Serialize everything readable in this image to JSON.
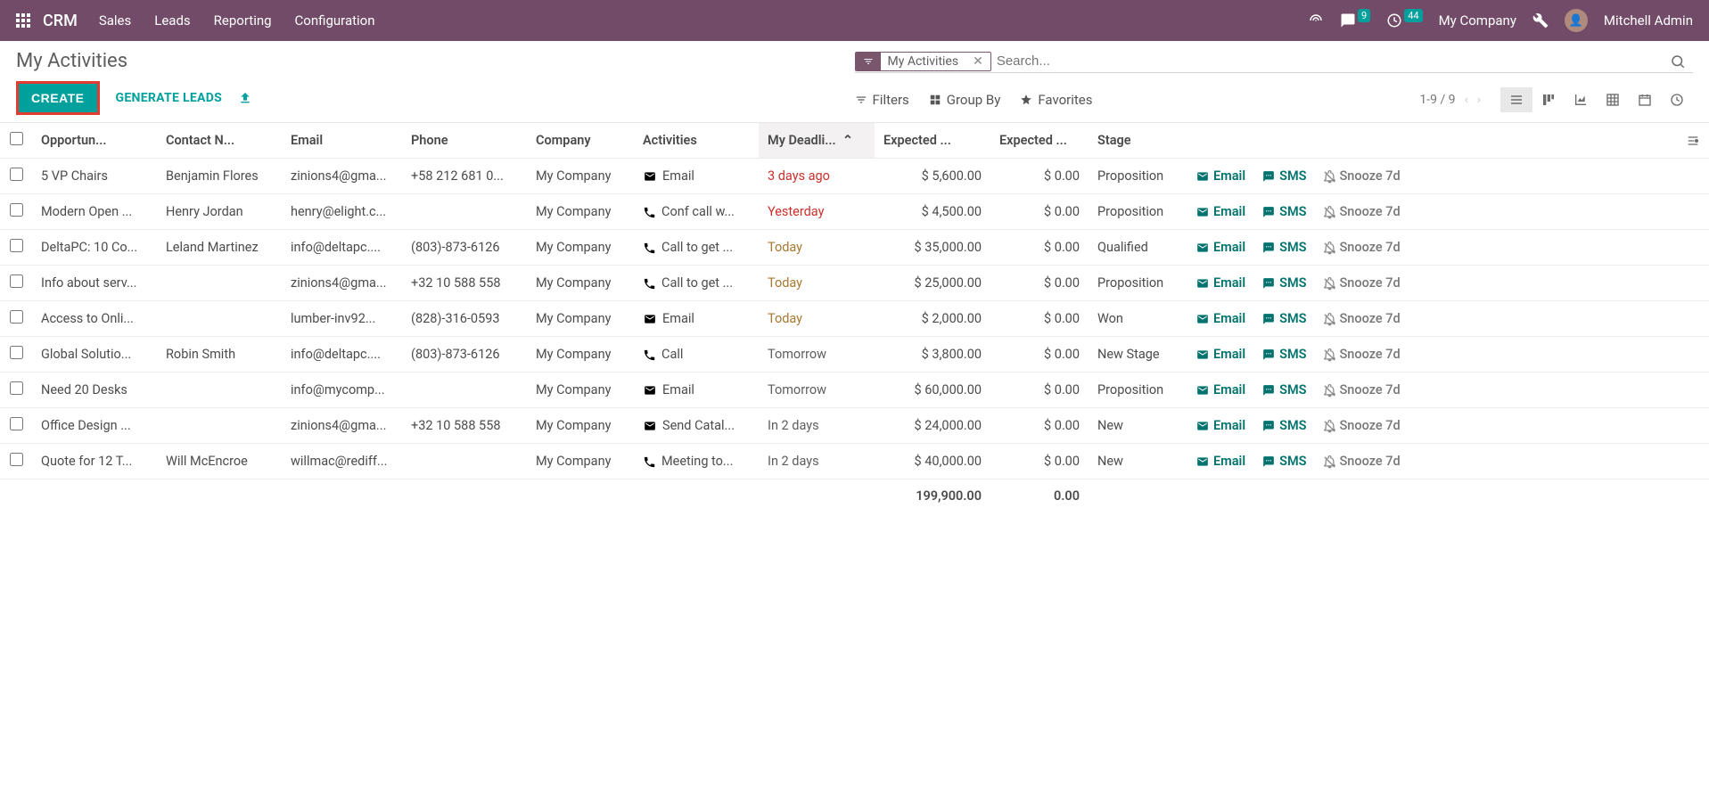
{
  "topnav": {
    "brand": "CRM",
    "menu": [
      "Sales",
      "Leads",
      "Reporting",
      "Configuration"
    ],
    "messages_badge": "9",
    "activities_badge": "44",
    "company": "My Company",
    "user": "Mitchell Admin"
  },
  "page_title": "My Activities",
  "actions": {
    "create": "CREATE",
    "generate_leads": "GENERATE LEADS"
  },
  "search": {
    "facet_label": "My Activities",
    "placeholder": "Search..."
  },
  "toolbar": {
    "filters": "Filters",
    "groupby": "Group By",
    "favorites": "Favorites",
    "pager": "1-9 / 9"
  },
  "columns": {
    "opportunity": "Opportun...",
    "contact": "Contact N...",
    "email": "Email",
    "phone": "Phone",
    "company": "Company",
    "activities": "Activities",
    "deadline": "My Deadli...",
    "expected_rev": "Expected ...",
    "expected_mrr": "Expected ...",
    "stage": "Stage"
  },
  "row_action_labels": {
    "email": "Email",
    "sms": "SMS",
    "snooze": "Snooze 7d"
  },
  "rows": [
    {
      "opportunity": "5 VP Chairs",
      "contact": "Benjamin Flores",
      "email": "zinions4@gma...",
      "phone": "+58 212 681 0...",
      "company": "My Company",
      "activity": "Email",
      "activity_icon": "envelope",
      "activity_color": "red",
      "deadline": "3 days ago",
      "deadline_color": "red",
      "expected_rev": "$ 5,600.00",
      "expected_mrr": "$ 0.00",
      "stage": "Proposition"
    },
    {
      "opportunity": "Modern Open ...",
      "contact": "Henry Jordan",
      "email": "henry@elight.c...",
      "phone": "",
      "company": "My Company",
      "activity": "Conf call w...",
      "activity_icon": "phone",
      "activity_color": "red",
      "deadline": "Yesterday",
      "deadline_color": "red",
      "expected_rev": "$ 4,500.00",
      "expected_mrr": "$ 0.00",
      "stage": "Proposition"
    },
    {
      "opportunity": "DeltaPC: 10 Co...",
      "contact": "Leland Martinez",
      "email": "info@deltapc....",
      "phone": "(803)-873-6126",
      "company": "My Company",
      "activity": "Call to get ...",
      "activity_icon": "phone",
      "activity_color": "brown",
      "deadline": "Today",
      "deadline_color": "brown",
      "expected_rev": "$ 35,000.00",
      "expected_mrr": "$ 0.00",
      "stage": "Qualified"
    },
    {
      "opportunity": "Info about serv...",
      "contact": "",
      "email": "zinions4@gma...",
      "phone": "+32 10 588 558",
      "company": "My Company",
      "activity": "Call to get ...",
      "activity_icon": "phone",
      "activity_color": "brown",
      "deadline": "Today",
      "deadline_color": "brown",
      "expected_rev": "$ 25,000.00",
      "expected_mrr": "$ 0.00",
      "stage": "Proposition"
    },
    {
      "opportunity": "Access to Onli...",
      "contact": "",
      "email": "lumber-inv92...",
      "phone": "(828)-316-0593",
      "company": "My Company",
      "activity": "Email",
      "activity_icon": "envelope",
      "activity_color": "brown",
      "deadline": "Today",
      "deadline_color": "brown",
      "expected_rev": "$ 2,000.00",
      "expected_mrr": "$ 0.00",
      "stage": "Won"
    },
    {
      "opportunity": "Global Solutio...",
      "contact": "Robin Smith",
      "email": "info@deltapc....",
      "phone": "(803)-873-6126",
      "company": "My Company",
      "activity": "Call",
      "activity_icon": "phone",
      "activity_color": "green",
      "deadline": "Tomorrow",
      "deadline_color": "normal",
      "expected_rev": "$ 3,800.00",
      "expected_mrr": "$ 0.00",
      "stage": "New Stage"
    },
    {
      "opportunity": "Need 20 Desks",
      "contact": "",
      "email": "info@mycomp...",
      "phone": "",
      "company": "My Company",
      "activity": "Email",
      "activity_icon": "envelope",
      "activity_color": "green",
      "deadline": "Tomorrow",
      "deadline_color": "normal",
      "expected_rev": "$ 60,000.00",
      "expected_mrr": "$ 0.00",
      "stage": "Proposition"
    },
    {
      "opportunity": "Office Design ...",
      "contact": "",
      "email": "zinions4@gma...",
      "phone": "+32 10 588 558",
      "company": "My Company",
      "activity": "Send Catal...",
      "activity_icon": "envelope",
      "activity_color": "green",
      "deadline": "In 2 days",
      "deadline_color": "normal",
      "expected_rev": "$ 24,000.00",
      "expected_mrr": "$ 0.00",
      "stage": "New"
    },
    {
      "opportunity": "Quote for 12 T...",
      "contact": "Will McEncroe",
      "email": "willmac@rediff...",
      "phone": "",
      "company": "My Company",
      "activity": "Meeting to...",
      "activity_icon": "phone",
      "activity_color": "green",
      "deadline": "In 2 days",
      "deadline_color": "normal",
      "expected_rev": "$ 40,000.00",
      "expected_mrr": "$ 0.00",
      "stage": "New"
    }
  ],
  "totals": {
    "expected_rev": "199,900.00",
    "expected_mrr": "0.00"
  }
}
